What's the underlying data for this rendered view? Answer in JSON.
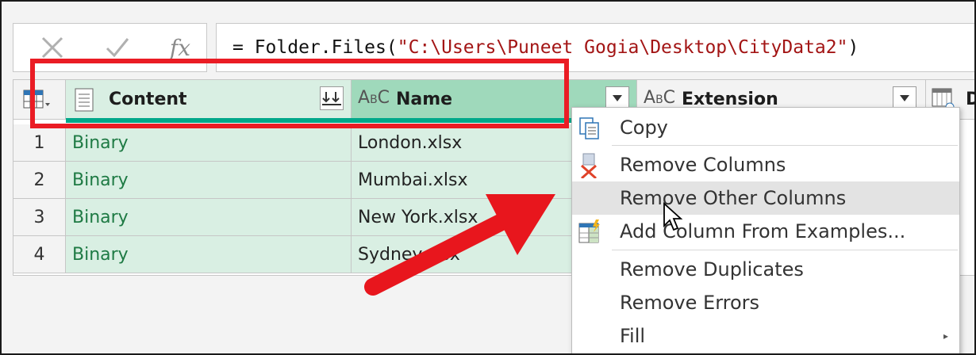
{
  "formula": {
    "cancel_icon": "cross-icon",
    "check_icon": "checkmark-icon",
    "fx_label": "fx",
    "prefix": "= Folder.Files(",
    "path": "\"C:\\Users\\Puneet Gogia\\Desktop\\CityData2\"",
    "suffix": ")"
  },
  "grid": {
    "columns": [
      {
        "label": "Content",
        "type_icon": "document-icon",
        "action_icon": "expand-binary-icon"
      },
      {
        "label": "Name",
        "type_icon": "ABC",
        "action_icon": "chevron-down-icon"
      },
      {
        "label": "Extension",
        "type_icon": "ABC",
        "action_icon": "chevron-down-icon"
      },
      {
        "label": "D",
        "type_icon": "calendar-icon"
      }
    ],
    "rows": [
      {
        "num": "1",
        "content": "Binary",
        "name": "London.xlsx"
      },
      {
        "num": "2",
        "content": "Binary",
        "name": "Mumbai.xlsx"
      },
      {
        "num": "3",
        "content": "Binary",
        "name": "New York.xlsx"
      },
      {
        "num": "4",
        "content": "Binary",
        "name": "Sydney.xlsx"
      }
    ]
  },
  "context_menu": {
    "items": [
      {
        "label": "Copy",
        "icon": "copy-icon"
      },
      {
        "label": "Remove Columns",
        "icon": "remove-columns-icon"
      },
      {
        "label": "Remove Other Columns",
        "icon": "",
        "hovered": true
      },
      {
        "label": "Add Column From Examples...",
        "icon": "add-column-examples-icon"
      },
      {
        "label": "Remove Duplicates",
        "icon": ""
      },
      {
        "label": "Remove Errors",
        "icon": ""
      },
      {
        "label": "Fill",
        "icon": "",
        "submenu": true
      }
    ]
  },
  "colors": {
    "selected_column": "#9fd9bb",
    "column_tint": "#d9efe3",
    "binary_text": "#1e7a44",
    "annotation_red": "#ea1c24",
    "teal_strip": "#00a88a"
  }
}
